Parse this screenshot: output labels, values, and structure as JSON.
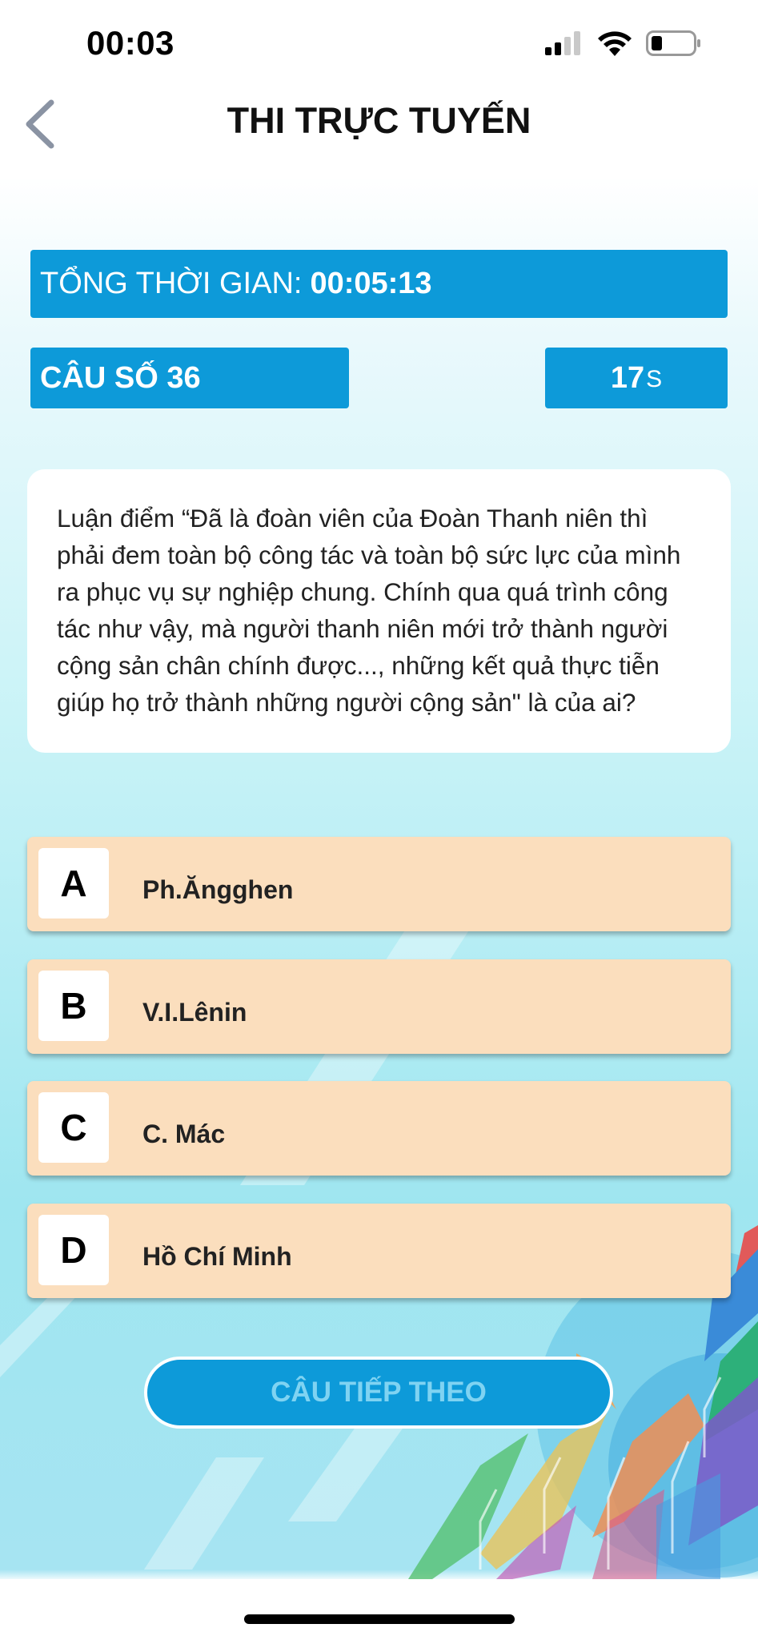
{
  "status_bar": {
    "time": "00:03",
    "icons": [
      "cellular-signal-icon",
      "wifi-icon",
      "battery-icon"
    ]
  },
  "header": {
    "title": "THI TRỰC TUYẾN",
    "back_icon": "chevron-left-icon"
  },
  "timer": {
    "total_label": "TỔNG THỜI GIAN:",
    "total_value": "00:05:13",
    "question_label": "CÂU SỐ 36",
    "seconds_value": "17",
    "seconds_unit": "S"
  },
  "question": {
    "text": "Luận điểm “Đã là đoàn viên của Đoàn Thanh niên thì phải đem toàn bộ công tác và toàn bộ sức lực của mình ra phục vụ sự nghiệp chung. Chính qua quá trình công tác như vậy, mà người thanh niên mới trở thành người cộng sản chân chính được..., những kết quả thực tiễn giúp họ trở thành những người cộng sản\" là của ai?"
  },
  "answers": [
    {
      "letter": "A",
      "text": "Ph.Ăngghen"
    },
    {
      "letter": "B",
      "text": "V.I.Lênin"
    },
    {
      "letter": "C",
      "text": "C. Mác"
    },
    {
      "letter": "D",
      "text": "Hồ Chí Minh"
    }
  ],
  "next_button": {
    "label": "CÂU TIẾP THEO"
  },
  "colors": {
    "accent_blue": "#0d9ad9",
    "answer_bg": "#fbdebd",
    "next_label": "#7fd3f2"
  }
}
